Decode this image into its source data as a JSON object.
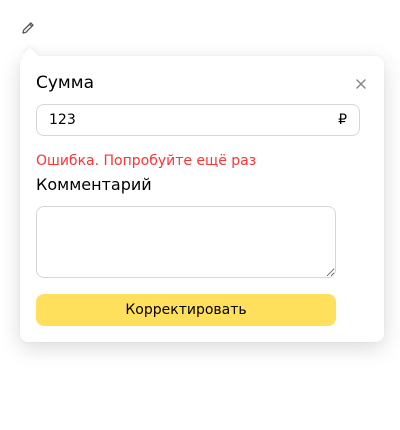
{
  "trigger": {
    "icon": "pencil-icon"
  },
  "popup": {
    "title": "Сумма",
    "close_icon": "close-icon",
    "amount": {
      "value": "123",
      "currency": "₽"
    },
    "error": "Ошибка. Попробуйте ещё раз",
    "comment": {
      "label": "Комментарий",
      "value": ""
    },
    "submit_label": "Корректировать"
  },
  "colors": {
    "error": "#ff3333",
    "button": "#ffe05c",
    "border": "#d6d6d6"
  }
}
